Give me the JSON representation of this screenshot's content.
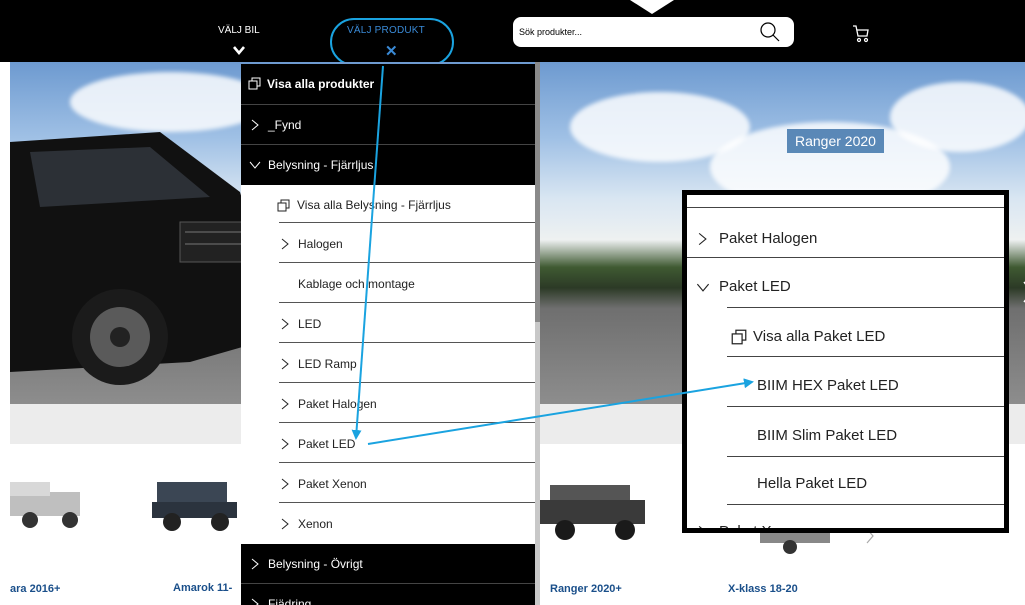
{
  "header": {
    "nav_car_label": "VÄLJ BIL",
    "nav_product_label": "VÄLJ PRODUKT",
    "nav_product_close": "✕",
    "search_placeholder": "Sök produkter..."
  },
  "hero": {
    "badge": "Ranger 2020"
  },
  "menu": {
    "top_items": [
      {
        "label": "Visa alla produkter",
        "icon": "copy-icon"
      },
      {
        "label": "_Fynd",
        "icon": "chevron-right-icon"
      },
      {
        "label": "Belysning - Fjärrljus",
        "icon": "chevron-down-icon",
        "expanded": true
      }
    ],
    "sub_items": [
      {
        "label": "Visa alla Belysning - Fjärrljus",
        "icon": "copy-icon"
      },
      {
        "label": "Halogen",
        "icon": "chevron-right-icon"
      },
      {
        "label": "Kablage och montage",
        "icon": "none"
      },
      {
        "label": "LED",
        "icon": "chevron-right-icon"
      },
      {
        "label": "LED Ramp",
        "icon": "chevron-right-icon"
      },
      {
        "label": "Paket Halogen",
        "icon": "chevron-right-icon"
      },
      {
        "label": "Paket LED",
        "icon": "chevron-right-icon"
      },
      {
        "label": "Paket Xenon",
        "icon": "chevron-right-icon"
      },
      {
        "label": "Xenon",
        "icon": "chevron-right-icon"
      }
    ],
    "bottom_items": [
      {
        "label": "Belysning - Övrigt",
        "icon": "chevron-right-icon"
      },
      {
        "label": "Fjädring",
        "icon": "chevron-right-icon"
      }
    ]
  },
  "zoom": {
    "items": [
      {
        "label": "Paket Halogen",
        "icon": "chevron-right-icon"
      },
      {
        "label": "Paket LED",
        "icon": "chevron-down-icon"
      },
      {
        "label": "Visa alla Paket LED",
        "icon": "copy-icon"
      },
      {
        "label": "BIIM HEX Paket LED",
        "icon": "none"
      },
      {
        "label": "BIIM Slim Paket LED",
        "icon": "none"
      },
      {
        "label": "Hella Paket LED",
        "icon": "none"
      },
      {
        "label": "Paket Xenon",
        "icon": "chevron-right-icon"
      }
    ]
  },
  "thumbnails": [
    {
      "label": "ara 2016+"
    },
    {
      "label": "Amarok 11-"
    },
    {
      "label": "Ranger 2020+"
    },
    {
      "label": "X-klass 18-20"
    }
  ],
  "colors": {
    "accent_blue": "#1aa3e0",
    "nav_active": "#3a8ad6",
    "thumb_label": "#1a4f8a"
  }
}
